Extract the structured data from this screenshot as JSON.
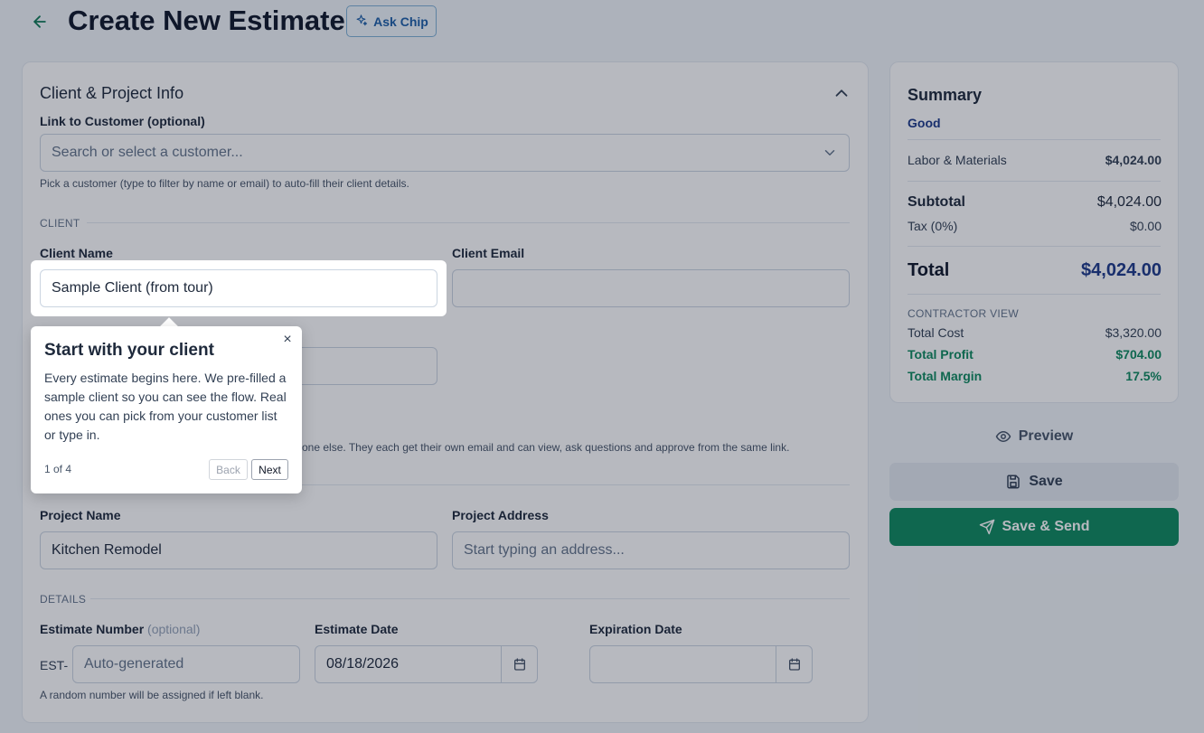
{
  "header": {
    "title": "Create New Estimate",
    "ask_chip_label": "Ask Chip"
  },
  "client_project": {
    "section_title": "Client & Project Info",
    "customer_link_label": "Link to Customer (optional)",
    "customer_search_placeholder": "Search or select a customer...",
    "customer_hint": "Pick a customer (type to filter by name or email) to auto-fill their client details.",
    "client_heading": "CLIENT",
    "client_name_label": "Client Name",
    "client_name_value": "Sample Client (from tour)",
    "client_email_label": "Client Email",
    "client_email_value": "",
    "additional_hint_fragment": "one else. They each get their own email and can view, ask questions and approve from the same link.",
    "project_name_label": "Project Name",
    "project_name_value": "Kitchen Remodel",
    "project_address_label": "Project Address",
    "project_address_placeholder": "Start typing an address...",
    "details_heading": "DETAILS",
    "estimate_number_label": "Estimate Number",
    "estimate_number_optional": "(optional)",
    "estimate_prefix": "EST-",
    "estimate_number_placeholder": "Auto-generated",
    "estimate_number_hint": "A random number will be assigned if left blank.",
    "estimate_date_label": "Estimate Date",
    "estimate_date_value": "08/18/2026",
    "expiration_date_label": "Expiration Date",
    "expiration_date_value": ""
  },
  "summary": {
    "title": "Summary",
    "tier": "Good",
    "labor_materials_label": "Labor & Materials",
    "labor_materials_value": "$4,024.00",
    "subtotal_label": "Subtotal",
    "subtotal_value": "$4,024.00",
    "tax_label": "Tax (0%)",
    "tax_value": "$0.00",
    "total_label": "Total",
    "total_value": "$4,024.00",
    "contractor_heading": "CONTRACTOR VIEW",
    "total_cost_label": "Total Cost",
    "total_cost_value": "$3,320.00",
    "total_profit_label": "Total Profit",
    "total_profit_value": "$704.00",
    "total_margin_label": "Total Margin",
    "total_margin_value": "17.5%"
  },
  "actions": {
    "preview_label": "Preview",
    "save_label": "Save",
    "save_send_label": "Save & Send"
  },
  "tour": {
    "title": "Start with your client",
    "body": "Every estimate begins here. We pre-filled a sample client so you can see the flow. Real ones you can pick from your customer list or type in.",
    "step": "1 of 4",
    "back_label": "Back",
    "next_label": "Next",
    "close_glyph": "×"
  },
  "colors": {
    "accent_green": "#0f8a5f",
    "tier_blue": "#1e3a8a",
    "chip_blue": "#1d5fa8"
  }
}
